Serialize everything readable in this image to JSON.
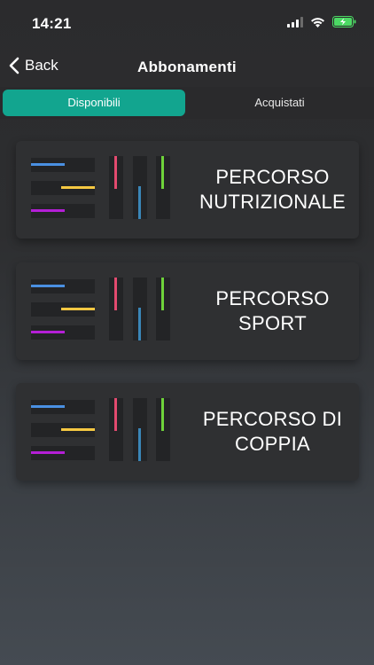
{
  "status_bar": {
    "time": "14:21"
  },
  "nav": {
    "back_label": "Back",
    "title": "Abbonamenti"
  },
  "tabs": [
    {
      "label": "Disponibili",
      "active": true
    },
    {
      "label": "Acquistati",
      "active": false
    }
  ],
  "cards": [
    {
      "title": "PERCORSO\nNUTRIZIONALE"
    },
    {
      "title": "PERCORSO\nSPORT"
    },
    {
      "title": "PERCORSO DI\nCOPPIA"
    }
  ],
  "colors": {
    "accent": "#12a58f",
    "bar_blue": "#4a90e2",
    "bar_yellow": "#f5c842",
    "bar_purple": "#b41fd6",
    "bar_red": "#e34a6f",
    "bar_teal": "#3a86b8",
    "bar_green": "#6ed23a",
    "battery_green": "#4cd964"
  }
}
